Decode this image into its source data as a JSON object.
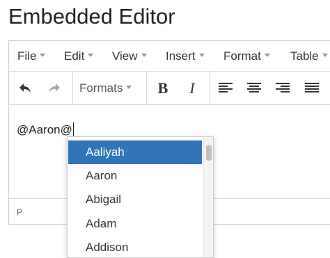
{
  "page": {
    "title": "Embedded Editor"
  },
  "menubar": [
    {
      "label": "File"
    },
    {
      "label": "Edit"
    },
    {
      "label": "View"
    },
    {
      "label": "Insert"
    },
    {
      "label": "Format"
    },
    {
      "label": "Table"
    }
  ],
  "toolbar": {
    "undo_icon": "undo-icon",
    "redo_icon": "redo-icon",
    "formats_label": "Formats",
    "bold_label": "B",
    "italic_label": "I",
    "align_icons": [
      "align-left-icon",
      "align-center-icon",
      "align-right-icon",
      "align-justify-icon"
    ]
  },
  "content": {
    "text": "@Aaron@"
  },
  "statusbar": {
    "path": "P"
  },
  "autocomplete": {
    "items": [
      "Aaliyah",
      "Aaron",
      "Abigail",
      "Adam",
      "Addison"
    ],
    "selected": "Aaliyah",
    "selected_color": "#3175b6"
  }
}
